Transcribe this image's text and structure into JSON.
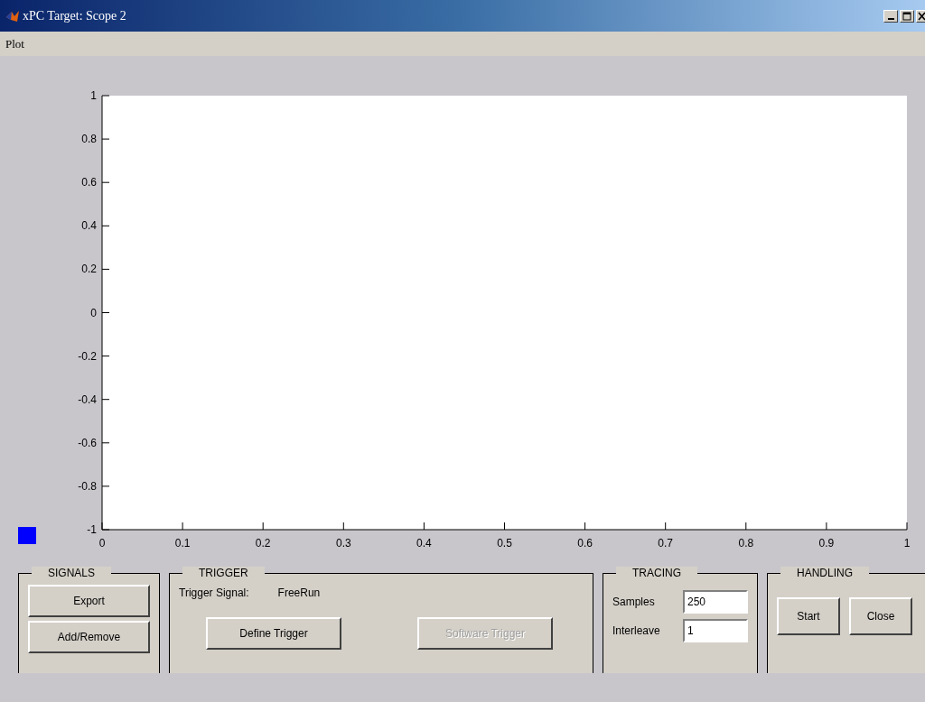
{
  "window": {
    "title": "xPC Target: Scope 2"
  },
  "menu": [
    "Plot"
  ],
  "chart_data": {
    "type": "line",
    "xlim": [
      0,
      1
    ],
    "ylim": [
      -1,
      1
    ],
    "xticks": [
      0,
      0.1,
      0.2,
      0.3,
      0.4,
      0.5,
      0.6,
      0.7,
      0.8,
      0.9,
      1
    ],
    "yticks": [
      -1,
      -0.8,
      -0.6,
      -0.4,
      -0.2,
      0,
      0.2,
      0.4,
      0.6,
      0.8,
      1
    ]
  },
  "signals": {
    "title": "SIGNALS",
    "markers": [
      {
        "color": "#0000ff"
      }
    ],
    "buttons": [
      {
        "label": "Export",
        "disabled": false
      },
      {
        "label": "Add/Remove",
        "disabled": false
      }
    ]
  },
  "trigger": {
    "title": "TRIGGER",
    "signal_label": "Trigger Signal:",
    "signal_value": "FreeRun",
    "buttons": [
      {
        "label": "Define Trigger",
        "disabled": false
      },
      {
        "label": "Software Trigger",
        "disabled": true
      }
    ]
  },
  "tracing": {
    "title": "TRACING",
    "fields": [
      {
        "label": "Samples",
        "value": "250"
      },
      {
        "label": "Interleave",
        "value": "1"
      }
    ]
  },
  "handling": {
    "title": "HANDLING",
    "buttons": [
      {
        "label": "Start",
        "disabled": false
      },
      {
        "label": "Close",
        "disabled": false
      }
    ]
  }
}
